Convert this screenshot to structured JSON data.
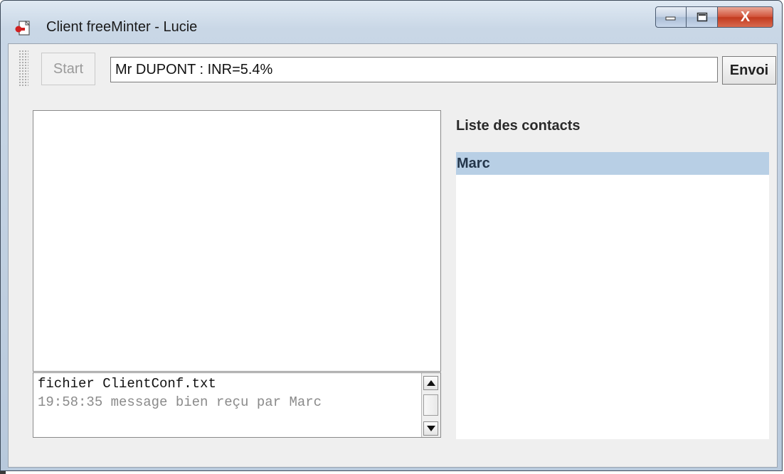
{
  "window": {
    "title": "Client freeMinter - Lucie",
    "close_glyph": "X"
  },
  "toolbar": {
    "start_label": "Start",
    "message_value": "Mr DUPONT : INR=5.4%",
    "send_label": "Envoi"
  },
  "log": {
    "lines": [
      "fichier ClientConf.txt",
      "19:58:35 message bien reçu par Marc"
    ]
  },
  "contacts": {
    "title": "Liste des contacts",
    "items": [
      {
        "label": "Marc",
        "selected": true
      }
    ]
  },
  "colors": {
    "selection": "#b8cfe5",
    "close_button": "#c23a1f",
    "window_frame": "#b8c9dc"
  },
  "icons": [
    "app-icon",
    "minimize-icon",
    "maximize-icon",
    "close-icon",
    "grip-icon",
    "arrow-up-icon",
    "arrow-down-icon"
  ]
}
